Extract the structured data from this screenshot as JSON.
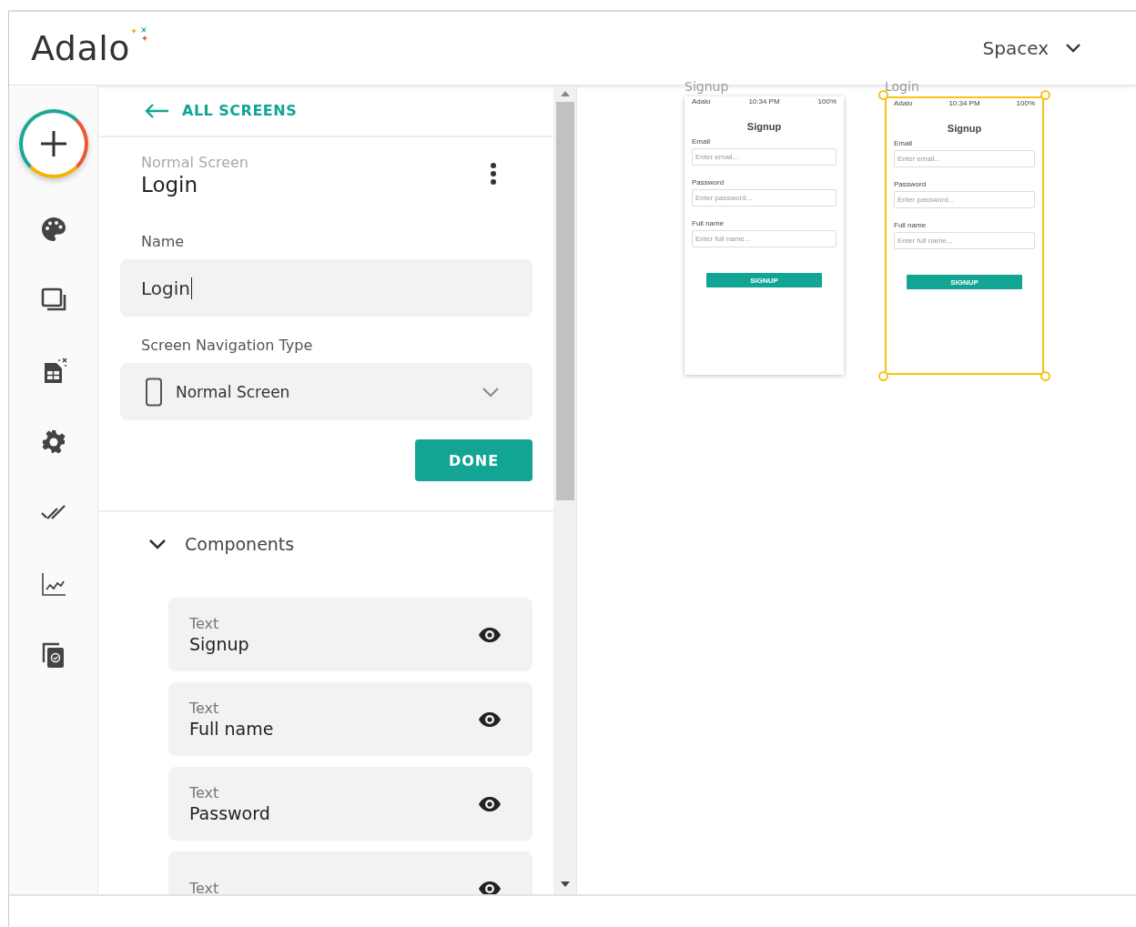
{
  "header": {
    "logo": "Adalo",
    "app_menu": "Spacex"
  },
  "sidebar": {
    "items": [
      {
        "kind": "palette"
      },
      {
        "kind": "screens"
      },
      {
        "kind": "database"
      },
      {
        "kind": "settings"
      },
      {
        "kind": "publish"
      },
      {
        "kind": "analytics"
      },
      {
        "kind": "clone"
      }
    ]
  },
  "panel": {
    "back_link": "ALL SCREENS",
    "screen_type": "Normal Screen",
    "screen_name": "Login",
    "name_label": "Name",
    "name_value": "Login",
    "nav_label": "Screen Navigation Type",
    "nav_value": "Normal Screen",
    "done_button": "DONE",
    "components": {
      "title": "Components",
      "expanded": true,
      "items": [
        {
          "type": "Text",
          "name": "Signup",
          "visible": true
        },
        {
          "type": "Text",
          "name": "Full name",
          "visible": true
        },
        {
          "type": "Text",
          "name": "Password",
          "visible": true
        },
        {
          "type": "Text",
          "visible": true
        }
      ]
    }
  },
  "canvas": {
    "screens": [
      {
        "title": "Signup",
        "selected": false,
        "carrier": "Adalo",
        "time": "10:34 PM",
        "battery": "100%",
        "heading": "Signup",
        "fields": [
          {
            "label": "Email",
            "placeholder": "Enter email..."
          },
          {
            "label": "Password",
            "placeholder": "Enter password..."
          },
          {
            "label": "Full name",
            "placeholder": "Enter full name..."
          }
        ],
        "button": "SIGNUP"
      },
      {
        "title": "Login",
        "selected": true,
        "carrier": "Adalo",
        "time": "10:34 PM",
        "battery": "100%",
        "heading": "Signup",
        "fields": [
          {
            "label": "Email",
            "placeholder": "Enter email..."
          },
          {
            "label": "Password",
            "placeholder": "Enter password..."
          },
          {
            "label": "Full name",
            "placeholder": "Enter full name..."
          }
        ],
        "button": "SIGNUP"
      }
    ]
  }
}
